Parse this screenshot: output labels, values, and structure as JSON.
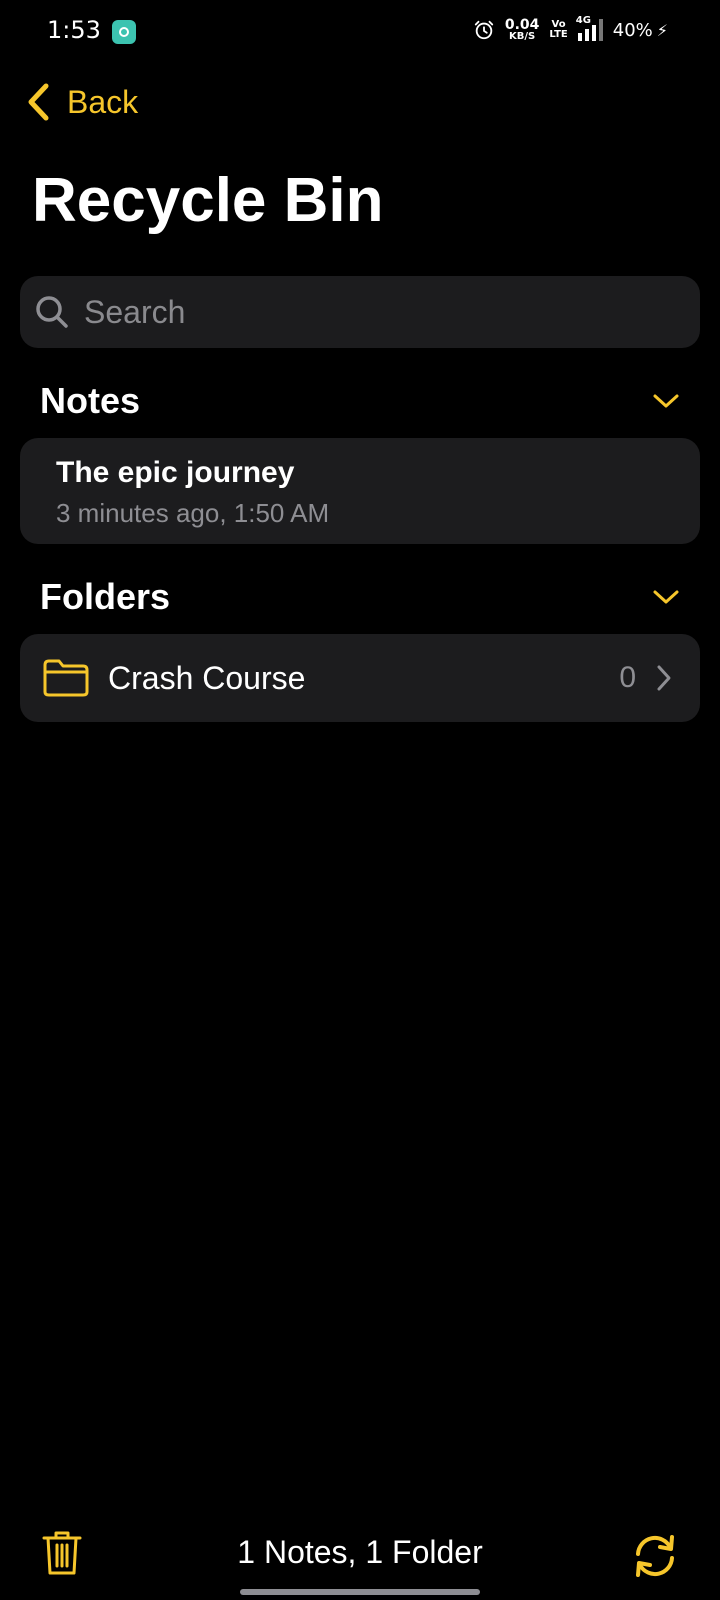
{
  "status_bar": {
    "time": "1:53",
    "net_speed_value": "0.04",
    "net_speed_unit": "KB/S",
    "volte_top": "Vo",
    "volte_bottom": "LTE",
    "network": "4G",
    "battery": "40%"
  },
  "header": {
    "back_label": "Back",
    "title": "Recycle Bin"
  },
  "search": {
    "placeholder": "Search",
    "value": ""
  },
  "notes_section": {
    "title": "Notes",
    "items": [
      {
        "title": "The epic journey",
        "meta": "3 minutes ago, 1:50 AM"
      }
    ]
  },
  "folders_section": {
    "title": "Folders",
    "items": [
      {
        "name": "Crash Course",
        "count": "0"
      }
    ]
  },
  "footer": {
    "summary": "1 Notes, 1 Folder"
  },
  "colors": {
    "accent": "#f6c62b",
    "background": "#000000",
    "card": "#1c1c1e",
    "secondary_text": "#8e8e93"
  },
  "icons": {
    "back": "chevron-left-icon",
    "search": "search-icon",
    "collapse": "chevron-down-icon",
    "folder": "folder-icon",
    "disclosure": "chevron-right-icon",
    "delete": "trash-icon",
    "restore": "restore-icon"
  }
}
